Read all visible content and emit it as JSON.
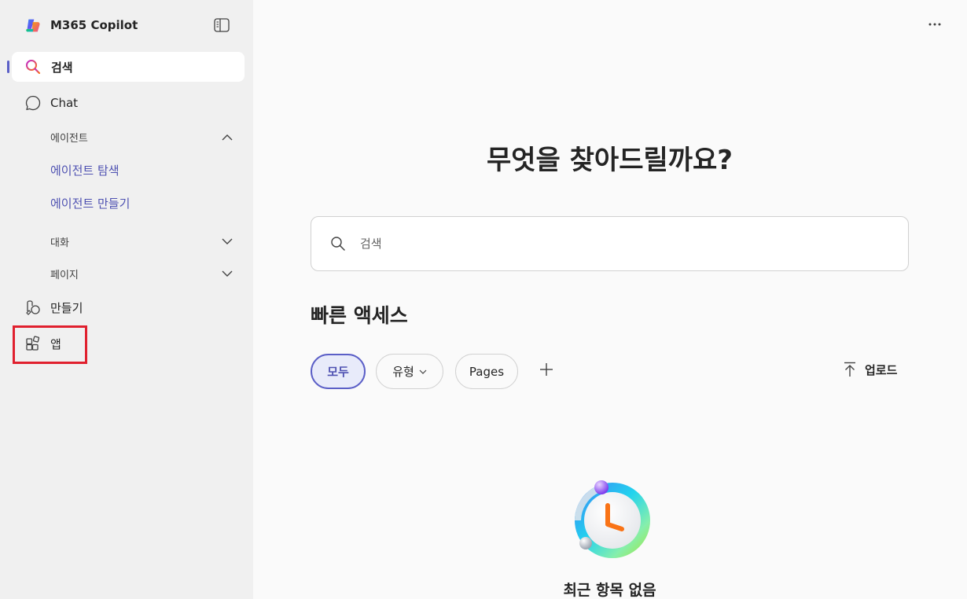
{
  "app": {
    "title": "M365 Copilot"
  },
  "sidebar": {
    "search_label": "검색",
    "chat_label": "Chat",
    "agents": {
      "header": "에이전트",
      "items": [
        "에이전트 탐색",
        "에이전트 만들기"
      ]
    },
    "conversations_label": "대화",
    "pages_label": "페이지",
    "create_label": "만들기",
    "apps_label": "앱",
    "user_text": "..."
  },
  "main": {
    "headline": "무엇을 찾아드릴까요?",
    "search": {
      "placeholder": "검색"
    },
    "quick_access": {
      "title": "빠른 액세스",
      "chips": [
        "모두",
        "유형",
        "Pages"
      ],
      "upload_label": "업로드"
    },
    "empty_state": {
      "text": "최근 항목 없음"
    }
  },
  "colors": {
    "accent": "#5b5fc7",
    "highlight": "#e0202e",
    "link": "#4f52b2"
  },
  "icons": [
    "copilot-logo-icon",
    "sidebar-toggle-icon",
    "search-icon",
    "chat-icon",
    "chevron-up-icon",
    "chevron-down-icon",
    "create-icon",
    "apps-icon",
    "more-icon",
    "plus-icon",
    "upload-icon",
    "clock-icon"
  ]
}
